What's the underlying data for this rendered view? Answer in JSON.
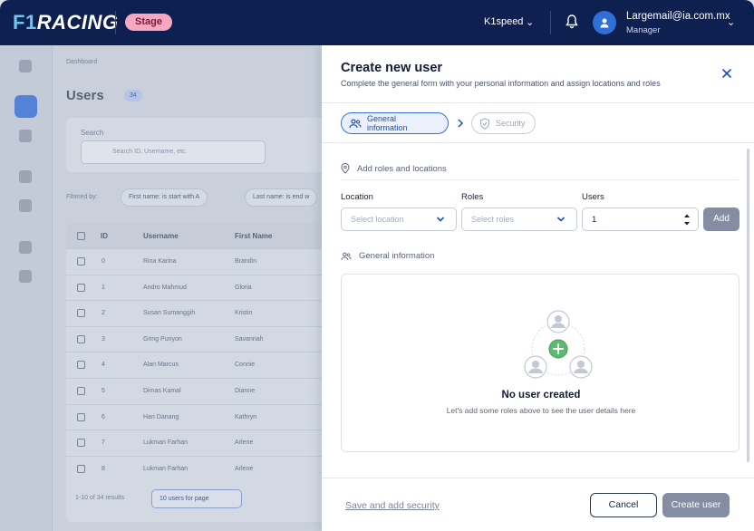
{
  "header": {
    "logo_f1": "F1",
    "logo_racing": "RACING",
    "stage_badge": "Stage",
    "company": "K1speed",
    "user_email": "Largemail@ia.com.mx",
    "user_role": "Manager"
  },
  "background": {
    "breadcrumb": "Dashboard",
    "title": "Users",
    "count": "34",
    "search_label": "Search",
    "search_placeholder": "Search ID, Username, etc.",
    "filtered_by": "Filtered by:",
    "chips": [
      "First name: is start with A",
      "Last name: is end w"
    ],
    "columns": [
      "ID",
      "Username",
      "First Name"
    ],
    "rows": [
      [
        "0",
        "Rina Karina",
        "Brandin"
      ],
      [
        "1",
        "Andro Mahmud",
        "Gloria"
      ],
      [
        "2",
        "Susan Sumanggih",
        "Kristin"
      ],
      [
        "3",
        "Gring Punyon",
        "Savannah"
      ],
      [
        "4",
        "Alan Marcus",
        "Connie"
      ],
      [
        "5",
        "Dimas Kamal",
        "Dianne"
      ],
      [
        "6",
        "Hari Danang",
        "Kathryn"
      ],
      [
        "7",
        "Lukman Farhan",
        "Arlene"
      ],
      [
        "8",
        "Lukman Farhan",
        "Arlene"
      ]
    ],
    "results": "1-10 of 34 results",
    "per_page": "10 users for page"
  },
  "drawer": {
    "title": "Create new user",
    "subtitle": "Complete the general form with your personal information and assign locations and roles",
    "steps": {
      "general": "General information",
      "security": "Security"
    },
    "roles_section": "Add roles and locations",
    "location_label": "Location",
    "location_placeholder": "Select location",
    "roles_label": "Roles",
    "roles_placeholder": "Select roles",
    "users_label": "Users",
    "users_value": "1",
    "add_button": "Add",
    "general_section": "General information",
    "empty_title": "No user created",
    "empty_subtitle": "Let's add some roles above to see the user details here",
    "save_link": "Save and add security",
    "cancel_button": "Cancel",
    "create_button": "Create user"
  },
  "colors": {
    "navbar": "#0e2050",
    "accent": "#3a6fd6",
    "stage_badge": "#f5a8c0",
    "disabled_button": "#858da3",
    "empty_plus": "#5dbb6f"
  }
}
